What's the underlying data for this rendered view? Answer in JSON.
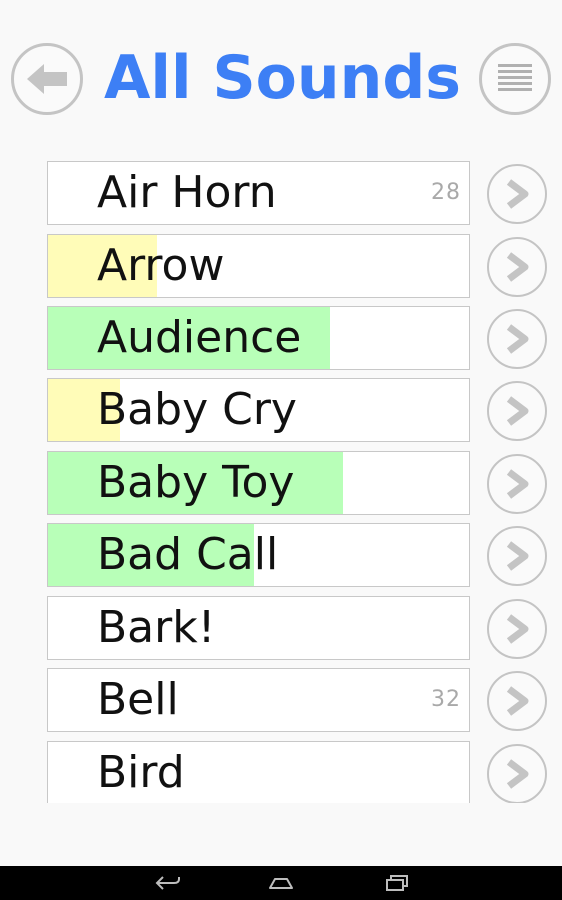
{
  "header": {
    "title": "All Sounds",
    "back_icon": "arrow-left-icon",
    "menu_icon": "list-lines-icon"
  },
  "colors": {
    "title": "#3d7ff5",
    "fill_yellow": "#fffcb8",
    "fill_green": "#b8ffb8",
    "border": "#c8c8c8"
  },
  "sounds": [
    {
      "label": "Air Horn",
      "count": "28",
      "fill": 0,
      "fill_color": "none"
    },
    {
      "label": "Arrow",
      "count": "",
      "fill": 0.26,
      "fill_color": "yellow"
    },
    {
      "label": "Audience",
      "count": "",
      "fill": 0.67,
      "fill_color": "green"
    },
    {
      "label": "Baby Cry",
      "count": "",
      "fill": 0.17,
      "fill_color": "yellow"
    },
    {
      "label": "Baby Toy",
      "count": "",
      "fill": 0.7,
      "fill_color": "green"
    },
    {
      "label": "Bad Call",
      "count": "",
      "fill": 0.49,
      "fill_color": "green"
    },
    {
      "label": "Bark!",
      "count": "",
      "fill": 0,
      "fill_color": "none"
    },
    {
      "label": "Bell",
      "count": "32",
      "fill": 0,
      "fill_color": "none"
    },
    {
      "label": "Bird",
      "count": "",
      "fill": 0,
      "fill_color": "none"
    }
  ],
  "navbar": {
    "back_icon": "nav-back-icon",
    "home_icon": "nav-home-icon",
    "recent_icon": "nav-recent-apps-icon"
  }
}
